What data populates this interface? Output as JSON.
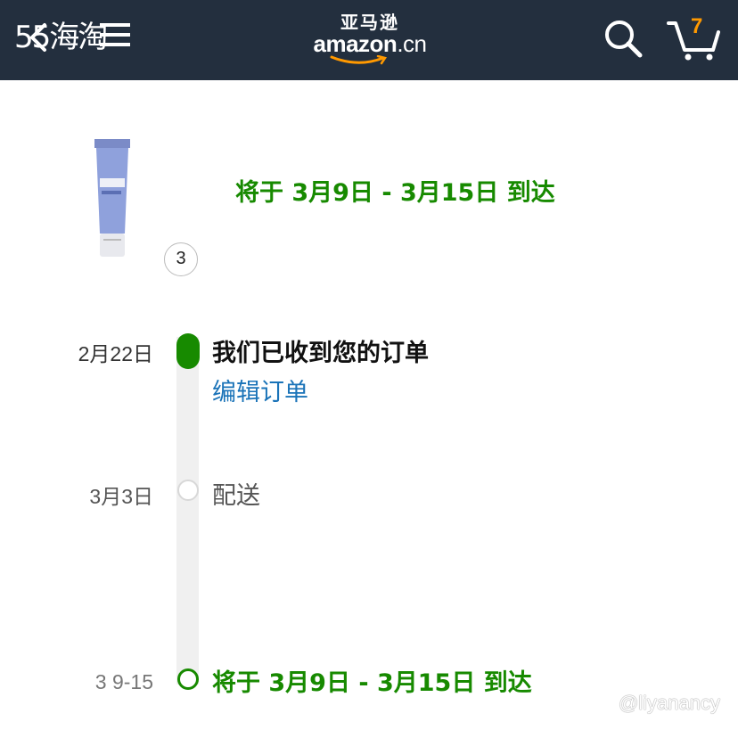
{
  "header": {
    "watermark": "55海淘",
    "logo_cn": "亚马逊",
    "logo_en": "amazon",
    "logo_domain": ".cn",
    "cart_count": "7",
    "background": "#232f3e"
  },
  "product": {
    "quantity": "3",
    "arrival": "将于 3月9日 - 3月15日 到达"
  },
  "timeline": {
    "steps": [
      {
        "date": "2月22日",
        "title": "我们已收到您的订单",
        "link": "编辑订单",
        "state": "done"
      },
      {
        "date": "3月3日",
        "title": "配送",
        "state": "pending"
      },
      {
        "date": "3 9-15",
        "title": "将于 3月9日 - 3月15日 到达",
        "state": "target"
      }
    ]
  },
  "credit": "@liyanancy",
  "colors": {
    "green": "#178a00",
    "link": "#1a73b8",
    "cart_badge": "#ff9900"
  }
}
